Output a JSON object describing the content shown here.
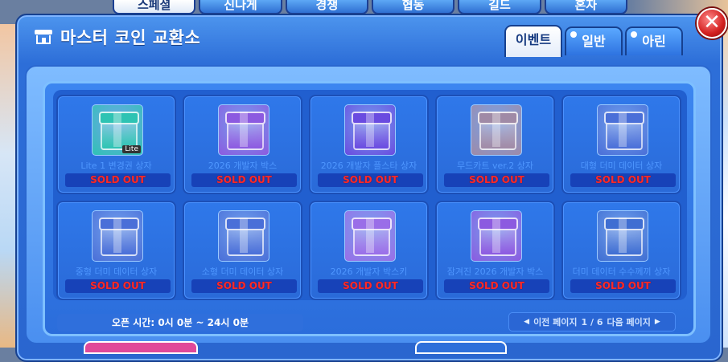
{
  "background": {
    "tabs": [
      "스페셜",
      "신나게",
      "경쟁",
      "협동",
      "길드",
      "혼자"
    ],
    "selected_tab": 0
  },
  "window": {
    "title": "마스터 코인 교환소",
    "close_symbol": "✕"
  },
  "tabs": [
    {
      "label": "이벤트",
      "active": true
    },
    {
      "label": "일반",
      "active": false
    },
    {
      "label": "아린",
      "active": false
    }
  ],
  "items": [
    {
      "name": "Lite 1 변경권 상자",
      "status": "SOLD OUT",
      "icon": "teal-chest-icon",
      "color": "#2ec3b3",
      "tag": "Lite"
    },
    {
      "name": "2026 개발자 박스",
      "status": "SOLD OUT",
      "icon": "purple-box-icon",
      "color": "#8c5ae0",
      "tag": ""
    },
    {
      "name": "2026 개발자 플스타 상자",
      "status": "SOLD OUT",
      "icon": "gift-box-icon",
      "color": "#6a4be0",
      "tag": ""
    },
    {
      "name": "무드카트 ver.2 상자",
      "status": "SOLD OUT",
      "icon": "kart-box-icon",
      "color": "#a08aa6",
      "tag": ""
    },
    {
      "name": "대형 더미 데이터 상자",
      "status": "SOLD OUT",
      "icon": "data-box-icon",
      "color": "#4a6fd8",
      "tag": ""
    },
    {
      "name": "중형 더미 데이터 상자",
      "status": "SOLD OUT",
      "icon": "data-box-icon",
      "color": "#4a6fd8",
      "tag": ""
    },
    {
      "name": "소형 더미 데이터 상자",
      "status": "SOLD OUT",
      "icon": "data-box-icon",
      "color": "#4a6fd8",
      "tag": ""
    },
    {
      "name": "2026 개발자 박스키",
      "status": "SOLD OUT",
      "icon": "key-icon",
      "color": "#9a6ee8",
      "tag": ""
    },
    {
      "name": "잠겨진 2026 개발자 박스",
      "status": "SOLD OUT",
      "icon": "purple-box-icon",
      "color": "#8c5ae0",
      "tag": ""
    },
    {
      "name": "더미 데이터 수수께끼 상자",
      "status": "SOLD OUT",
      "icon": "data-box-icon",
      "color": "#3f6ed2",
      "tag": ""
    }
  ],
  "footer": {
    "open_time": "오픈 시간: 0시 0분 ~ 24시 0분",
    "prev_label": "이전 페이지",
    "page_indicator": "1 / 6",
    "next_label": "다음 페이지"
  }
}
